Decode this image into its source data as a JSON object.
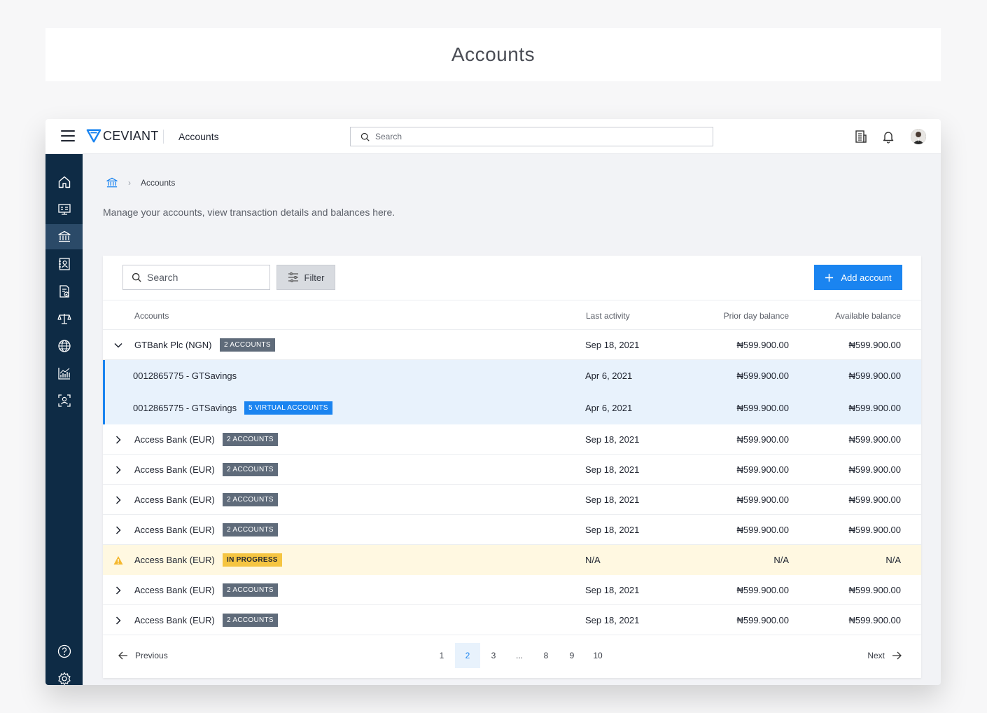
{
  "banner": {
    "title": "Accounts"
  },
  "topbar": {
    "brand": "CEVIANT",
    "title": "Accounts",
    "search_placeholder": "Search"
  },
  "sidebar": {
    "items": [
      {
        "icon": "home-icon"
      },
      {
        "icon": "dashboard-icon"
      },
      {
        "icon": "bank-icon",
        "active": true
      },
      {
        "icon": "contacts-icon"
      },
      {
        "icon": "document-check-icon"
      },
      {
        "icon": "scale-icon"
      },
      {
        "icon": "globe-icon"
      },
      {
        "icon": "analytics-icon"
      },
      {
        "icon": "user-scan-icon"
      },
      {
        "icon": "help-icon"
      },
      {
        "icon": "settings-icon"
      }
    ]
  },
  "breadcrumb": {
    "current": "Accounts"
  },
  "subtitle": "Manage your accounts, view transaction details and balances here.",
  "toolbar": {
    "search_placeholder": "Search",
    "filter_label": "Filter",
    "add_label": "Add account"
  },
  "table": {
    "headers": {
      "accounts": "Accounts",
      "last_activity": "Last activity",
      "prior_day": "Prior day balance",
      "available": "Available balance"
    },
    "rows": [
      {
        "type": "parent",
        "expanded": true,
        "name": "GTBank Plc (NGN)",
        "badge": "2 ACCOUNTS",
        "last": "Sep 18, 2021",
        "prior": "₦599.900.00",
        "avail": "₦599.900.00"
      },
      {
        "type": "child",
        "name": "0012865775 - GTSavings",
        "badge": "",
        "last": "Apr 6, 2021",
        "prior": "₦599.900.00",
        "avail": "₦599.900.00"
      },
      {
        "type": "child",
        "name": "0012865775 - GTSavings",
        "badge": "5 VIRTUAL ACCOUNTS",
        "last": "Apr 6, 2021",
        "prior": "₦599.900.00",
        "avail": "₦599.900.00"
      },
      {
        "type": "parent",
        "name": "Access Bank (EUR)",
        "badge": "2 ACCOUNTS",
        "last": "Sep 18, 2021",
        "prior": "₦599.900.00",
        "avail": "₦599.900.00"
      },
      {
        "type": "parent",
        "name": "Access Bank (EUR)",
        "badge": "2 ACCOUNTS",
        "last": "Sep 18, 2021",
        "prior": "₦599.900.00",
        "avail": "₦599.900.00"
      },
      {
        "type": "parent",
        "name": "Access Bank (EUR)",
        "badge": "2 ACCOUNTS",
        "last": "Sep 18, 2021",
        "prior": "₦599.900.00",
        "avail": "₦599.900.00"
      },
      {
        "type": "parent",
        "name": "Access Bank (EUR)",
        "badge": "2 ACCOUNTS",
        "last": "Sep 18, 2021",
        "prior": "₦599.900.00",
        "avail": "₦599.900.00"
      },
      {
        "type": "warn",
        "name": "Access Bank (EUR)",
        "badge": "IN PROGRESS",
        "last": "N/A",
        "prior": "N/A",
        "avail": "N/A"
      },
      {
        "type": "parent",
        "name": "Access Bank (EUR)",
        "badge": "2 ACCOUNTS",
        "last": "Sep 18, 2021",
        "prior": "₦599.900.00",
        "avail": "₦599.900.00"
      },
      {
        "type": "parent",
        "name": "Access Bank (EUR)",
        "badge": "2 ACCOUNTS",
        "last": "Sep 18, 2021",
        "prior": "₦599.900.00",
        "avail": "₦599.900.00"
      }
    ]
  },
  "pagination": {
    "prev": "Previous",
    "next": "Next",
    "pages": [
      "1",
      "2",
      "3",
      "...",
      "8",
      "9",
      "10"
    ],
    "current": "2"
  },
  "colors": {
    "accent": "#1a84f0",
    "sidebar": "#0e2b45",
    "warning": "#f5c542"
  }
}
